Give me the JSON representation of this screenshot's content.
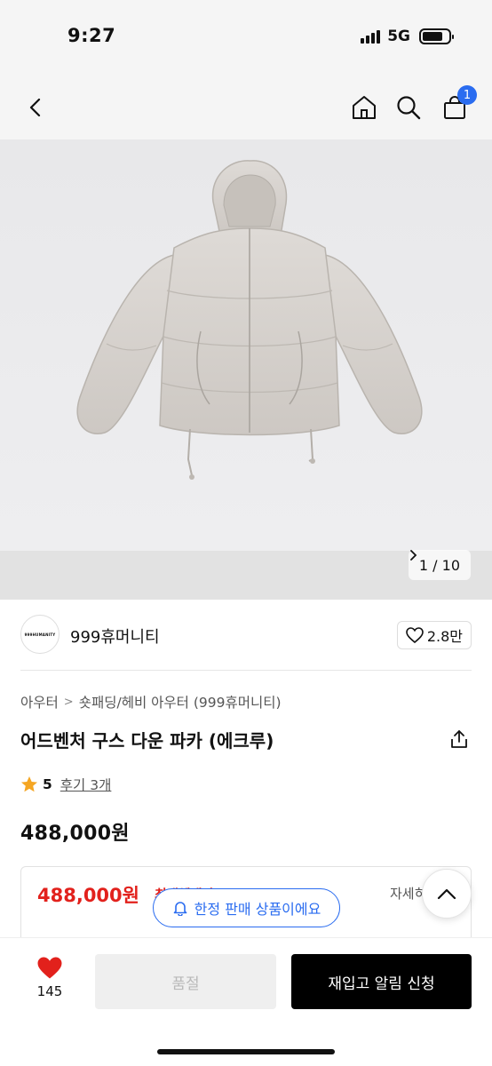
{
  "status_bar": {
    "time": "9:27",
    "network": "5G"
  },
  "nav": {
    "cart_count": "1"
  },
  "gallery": {
    "indicator": "1 / 10"
  },
  "brand": {
    "logo_text": "999HUMANITY",
    "name": "999휴머니티",
    "likes": "2.8만"
  },
  "breadcrumb": {
    "level1": "아우터",
    "level2": "숏패딩/헤비 아우터 (999휴머니티)"
  },
  "product": {
    "title": "어드벤처 구스 다운 파카 (에크루)",
    "rating": "5",
    "review_link": "후기 3개",
    "price": "488,000원"
  },
  "benefit": {
    "price": "488,000원",
    "tag": "최대혜택가",
    "detail_label": "자세히"
  },
  "notice": {
    "limited_label": "한정 판매 상품이에요"
  },
  "bottom_bar": {
    "wish_count": "145",
    "soldout_label": "품절",
    "restock_label": "재입고 알림 신청"
  },
  "colors": {
    "accent_blue": "#2a6cf0",
    "sale_red": "#e2211c",
    "heart_red": "#e2211c",
    "star": "#f5a623"
  }
}
